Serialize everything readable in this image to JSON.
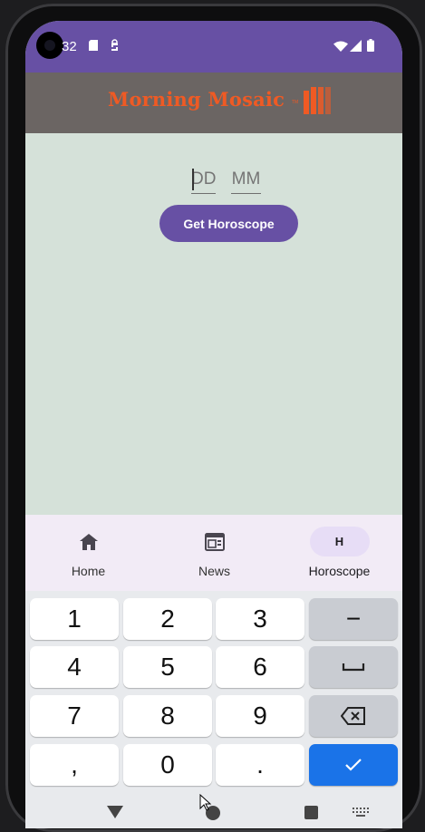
{
  "status_bar": {
    "time": "32"
  },
  "header": {
    "logo_text": "Morning Mosaic",
    "logo_tm": "TM",
    "brand_color": "#ef5a24"
  },
  "form": {
    "day_placeholder": "DD",
    "month_placeholder": "MM",
    "submit_label": "Get Horoscope"
  },
  "bottom_nav": {
    "items": [
      {
        "label": "Home",
        "icon": "home-icon"
      },
      {
        "label": "News",
        "icon": "newspaper-icon"
      },
      {
        "label": "Horoscope",
        "icon": "H",
        "active": true
      }
    ]
  },
  "keyboard": {
    "rows": [
      [
        "1",
        "2",
        "3",
        "−"
      ],
      [
        "4",
        "5",
        "6",
        "space"
      ],
      [
        "7",
        "8",
        "9",
        "backspace"
      ],
      [
        ",",
        "0",
        ".",
        "done"
      ]
    ]
  },
  "colors": {
    "primary": "#6750a4",
    "background": "#d5e1d9",
    "header": "#6b6563",
    "done_key": "#1a73e8"
  }
}
